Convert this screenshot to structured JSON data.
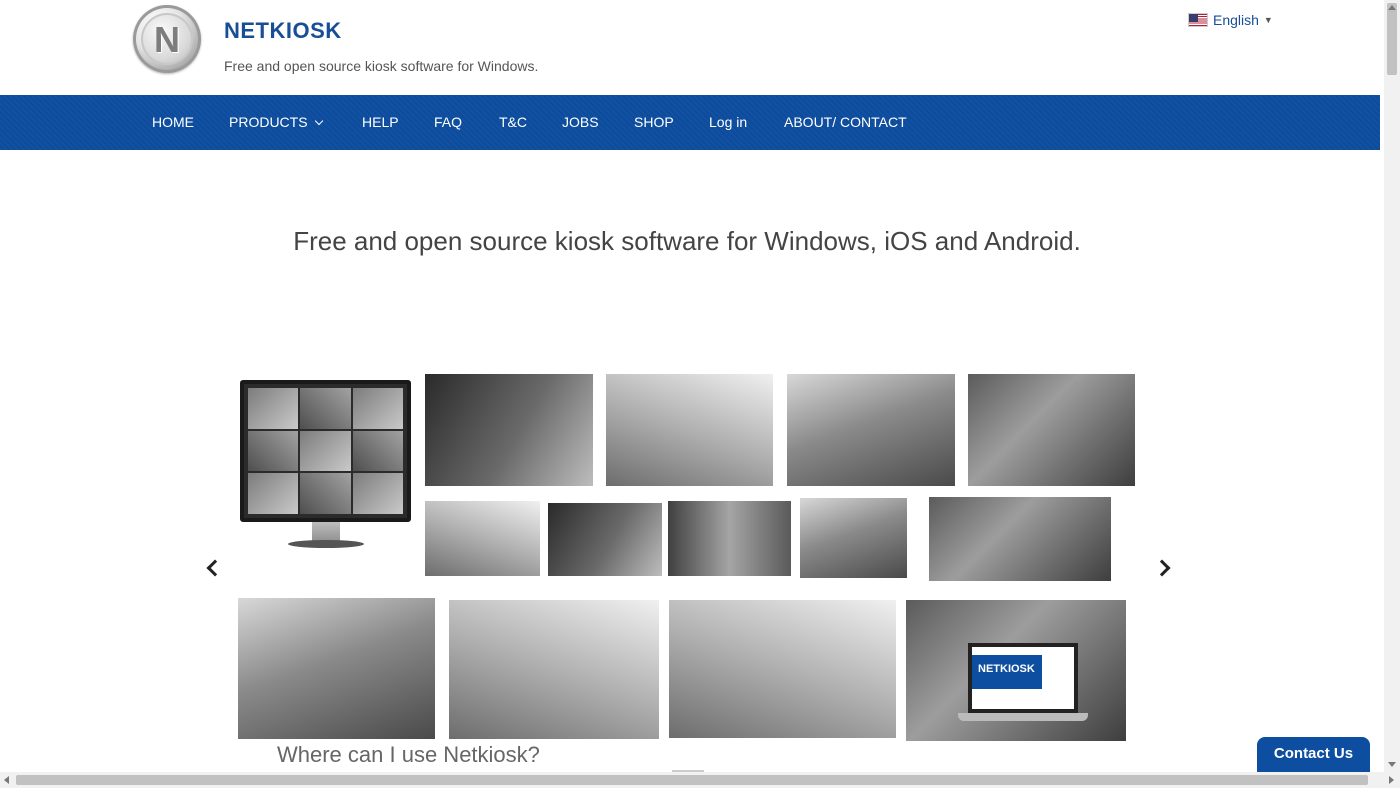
{
  "header": {
    "logo_letter": "N",
    "site_title": "NETKIOSK",
    "tagline": "Free and open source kiosk software for Windows.",
    "language": {
      "label": "English",
      "flag_icon": "us-flag-icon"
    }
  },
  "nav": {
    "items": [
      {
        "label": "HOME"
      },
      {
        "label": "PRODUCTS",
        "has_dropdown": true
      },
      {
        "label": "HELP"
      },
      {
        "label": "FAQ"
      },
      {
        "label": "T&C"
      },
      {
        "label": "JOBS"
      },
      {
        "label": "SHOP"
      },
      {
        "label": "Log in"
      },
      {
        "label": "ABOUT/ CONTACT"
      }
    ]
  },
  "hero": {
    "title": "Free and open source kiosk software for Windows, iOS and Android."
  },
  "collage": {
    "laptop_text": "NETKIOSK"
  },
  "section": {
    "title": "Where can I use Netkiosk?"
  },
  "contact": {
    "label": "Contact Us"
  },
  "colors": {
    "brand_blue": "#0d4ea0",
    "title_blue": "#174e96"
  }
}
